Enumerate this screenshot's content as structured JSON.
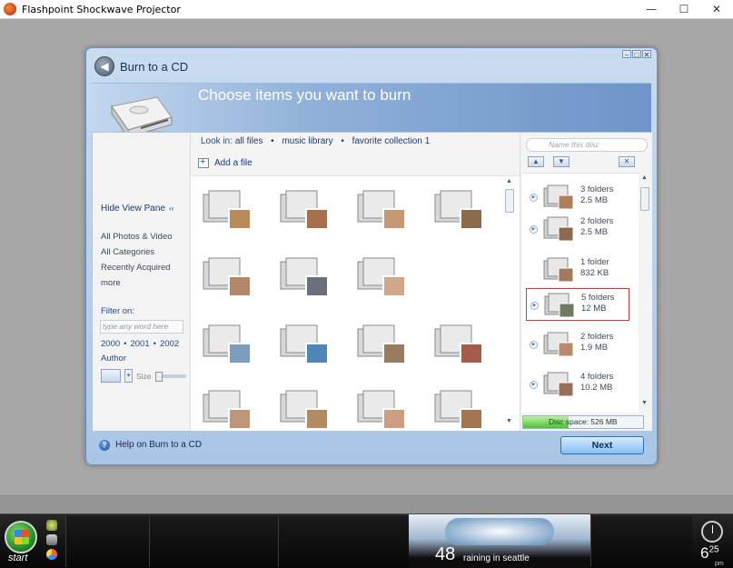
{
  "window": {
    "title": "Flashpoint Shockwave Projector",
    "controls": [
      "—",
      "☐",
      "✕"
    ]
  },
  "dialog": {
    "title": "Burn to a CD",
    "banner": "Choose items you want to burn",
    "look_in": {
      "label": "Look in:",
      "options": [
        "all files",
        "music library",
        "favorite collection 1"
      ]
    },
    "add_file": "Add a file",
    "hide_view_pane": "Hide View Pane",
    "left_links": [
      "All Photos & Video",
      "All Categories",
      "Recently Acquired",
      "more"
    ],
    "filter": {
      "label": "Filter on:",
      "placeholder": "type any word here",
      "years": [
        "2000",
        "2001",
        "2002"
      ],
      "author": "Author",
      "size_label": "Size"
    },
    "disc_name_placeholder": "Name this disc",
    "folders": [
      {
        "count": "3 folders",
        "size": "2.5 MB"
      },
      {
        "count": "2 folders",
        "size": "2.5 MB"
      },
      {
        "count": "1 folder",
        "size": "832 KB"
      },
      {
        "count": "5 folders",
        "size": "12 MB"
      },
      {
        "count": "2 folders",
        "size": "1.9 MB"
      },
      {
        "count": "4 folders",
        "size": "10.2 MB"
      }
    ],
    "disc_space": "Disc space: 526 MB",
    "disc_space_fraction": 0.38,
    "help": "Help on Burn to a CD",
    "next": "Next"
  },
  "taskbar": {
    "start": "start",
    "temperature": "48",
    "weather": "raining in seattle",
    "time": "6",
    "time_minutes": "25",
    "ampm": "pm"
  },
  "colors": {
    "accent": "#2f6fbd",
    "selected_border": "#e03434"
  }
}
